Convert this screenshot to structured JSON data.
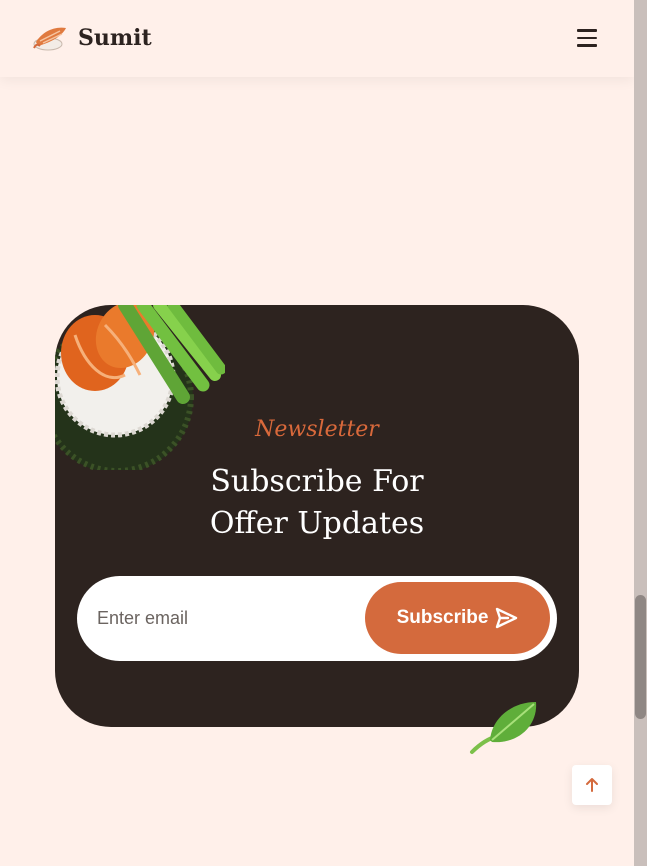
{
  "header": {
    "brand": "Sumit",
    "logo_icon": "sushi-logo-icon",
    "menu_icon": "hamburger-menu-icon"
  },
  "newsletter": {
    "eyebrow": "Newsletter",
    "title_line1": "Subscribe For",
    "title_line2": "Offer Updates",
    "email_placeholder": "Enter email",
    "email_value": "",
    "subscribe_label": "Subscribe",
    "send_icon": "send-arrow-icon"
  },
  "colors": {
    "page_bg": "#fff0ea",
    "card_bg": "#2d231f",
    "accent": "#d46a3d",
    "text_dark": "#2d2320"
  },
  "scroll_top_icon": "arrow-up-icon"
}
